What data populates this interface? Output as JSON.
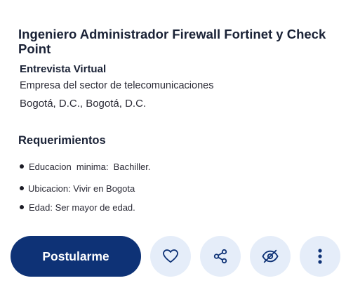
{
  "job": {
    "title": "Ingeniero Administrador Firewall Fortinet y Check Point",
    "interview_type": "Entrevista Virtual",
    "company": "Empresa del sector de telecomunicaciones",
    "location": "Bogotá, D.C., Bogotá, D.C."
  },
  "requirements": {
    "heading": "Requerimientos",
    "items": [
      "Educacion  minima:  Bachiller.",
      "Ubicacion: Vivir en Bogota",
      "Edad: Ser mayor de edad."
    ]
  },
  "actions": {
    "apply_label": "Postularme",
    "icons": {
      "favorite": "heart-icon",
      "share": "share-icon",
      "hide": "eye-off-icon",
      "more": "more-vertical-icon"
    }
  },
  "colors": {
    "primary": "#0e3276",
    "icon_button_bg": "#e5edf9",
    "icon_color": "#0e3276",
    "title_text": "#1a2236"
  }
}
